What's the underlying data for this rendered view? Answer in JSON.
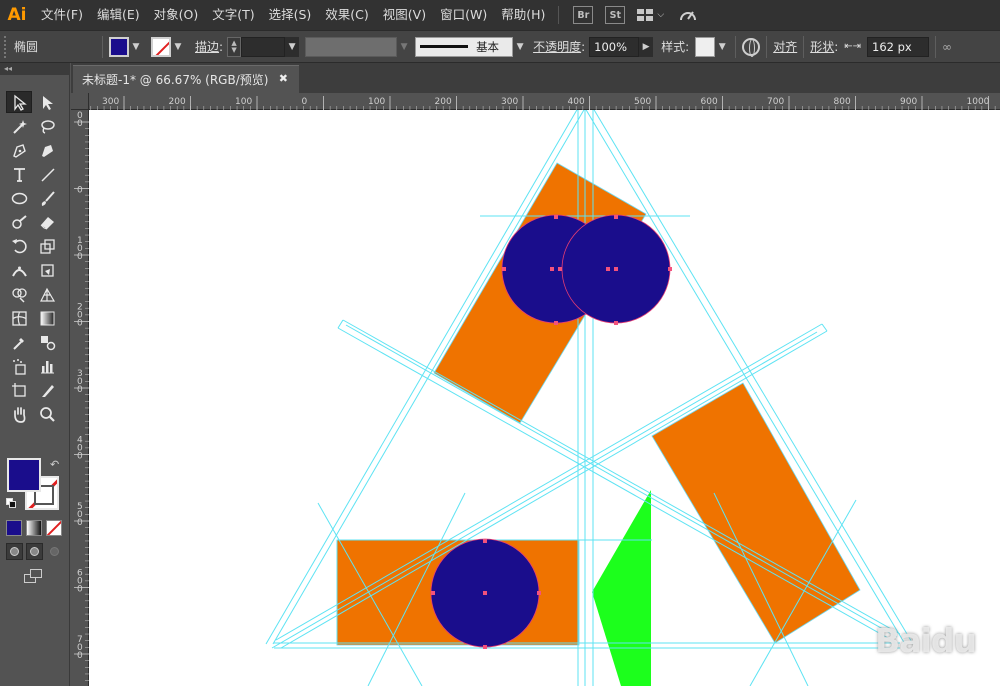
{
  "app": {
    "logo": "Ai",
    "menu": [
      "文件(F)",
      "编辑(E)",
      "对象(O)",
      "文字(T)",
      "选择(S)",
      "效果(C)",
      "视图(V)",
      "窗口(W)",
      "帮助(H)"
    ],
    "bridge_label": "Br",
    "stock_label": "St"
  },
  "control_bar": {
    "object_type": "椭圆",
    "stroke_label": "描边",
    "stroke_profile": "基本",
    "opacity_label": "不透明度",
    "opacity_value": "100%",
    "style_label": "样式",
    "align_label": "对齐",
    "shape_label": "形状",
    "width_value": "162 px",
    "fill_color": "#1a0d8c",
    "stroke_color": "none"
  },
  "document": {
    "tab_title": "未标题-1* @ 66.67% (RGB/预览)",
    "close_icon": "close-icon"
  },
  "rulers": {
    "top_ticks": [
      "300",
      "200",
      "100",
      "0",
      "100",
      "200",
      "300",
      "400",
      "500",
      "600",
      "700",
      "800",
      "900",
      "1000"
    ],
    "left_ticks": [
      "100",
      "0",
      "100",
      "200",
      "300",
      "400",
      "500",
      "600",
      "700"
    ]
  },
  "tools": [
    "selection-tool",
    "direct-selection-tool",
    "magic-wand-tool",
    "lasso-tool",
    "pen-tool",
    "curvature-tool",
    "type-tool",
    "line-segment-tool",
    "ellipse-tool",
    "paintbrush-tool",
    "shaper-tool",
    "eraser-tool",
    "rotate-tool",
    "scale-tool",
    "width-tool",
    "free-transform-tool",
    "shape-builder-tool",
    "perspective-grid-tool",
    "mesh-tool",
    "gradient-tool",
    "eyedropper-tool",
    "blend-tool",
    "symbol-sprayer-tool",
    "column-graph-tool",
    "artboard-tool",
    "slice-tool",
    "hand-tool",
    "zoom-tool"
  ],
  "artwork": {
    "orange": "#ef7300",
    "navy": "#1a0d8c",
    "green": "#1cff1c",
    "guide_color": "#5ee3f3"
  },
  "watermark": "Baidu"
}
